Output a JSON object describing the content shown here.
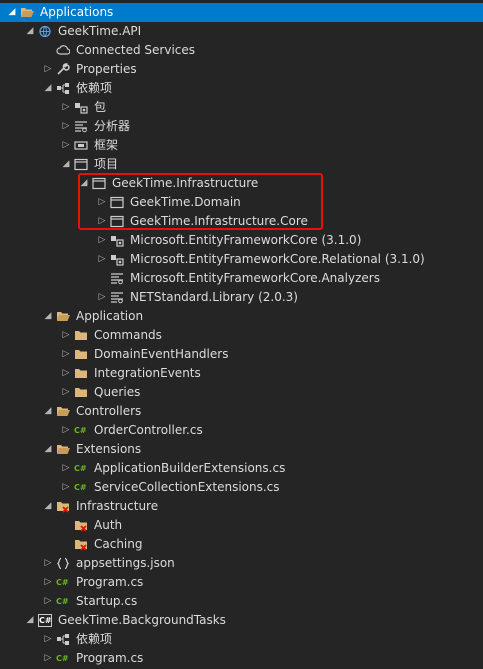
{
  "tree": {
    "items": [
      {
        "label": "Applications",
        "icon": "folder-open",
        "arrow": "expanded",
        "indent": 0,
        "selected": true
      },
      {
        "label": "GeekTime.API",
        "icon": "web-project",
        "arrow": "expanded",
        "indent": 1
      },
      {
        "label": "Connected Services",
        "icon": "connected-services",
        "arrow": "none",
        "indent": 2
      },
      {
        "label": "Properties",
        "icon": "wrench",
        "arrow": "collapsed",
        "indent": 2
      },
      {
        "label": "依赖项",
        "icon": "dependencies",
        "arrow": "expanded",
        "indent": 2
      },
      {
        "label": "包",
        "icon": "package",
        "arrow": "collapsed",
        "indent": 3
      },
      {
        "label": "分析器",
        "icon": "analyzer",
        "arrow": "collapsed",
        "indent": 3
      },
      {
        "label": "框架",
        "icon": "framework",
        "arrow": "collapsed",
        "indent": 3
      },
      {
        "label": "项目",
        "icon": "project-ref",
        "arrow": "expanded",
        "indent": 3
      },
      {
        "label": "GeekTime.Infrastructure",
        "icon": "project-ref",
        "arrow": "expanded",
        "indent": 4
      },
      {
        "label": "GeekTime.Domain",
        "icon": "project-ref",
        "arrow": "collapsed",
        "indent": 5
      },
      {
        "label": "GeekTime.Infrastructure.Core",
        "icon": "project-ref",
        "arrow": "collapsed",
        "indent": 5
      },
      {
        "label": "Microsoft.EntityFrameworkCore (3.1.0)",
        "icon": "package",
        "arrow": "collapsed",
        "indent": 5
      },
      {
        "label": "Microsoft.EntityFrameworkCore.Relational (3.1.0)",
        "icon": "package",
        "arrow": "collapsed",
        "indent": 5
      },
      {
        "label": "Microsoft.EntityFrameworkCore.Analyzers",
        "icon": "analyzer",
        "arrow": "none",
        "indent": 5
      },
      {
        "label": "NETStandard.Library (2.0.3)",
        "icon": "analyzer",
        "arrow": "collapsed",
        "indent": 5
      },
      {
        "label": "Application",
        "icon": "folder-open",
        "arrow": "expanded",
        "indent": 2
      },
      {
        "label": "Commands",
        "icon": "folder",
        "arrow": "collapsed",
        "indent": 3
      },
      {
        "label": "DomainEventHandlers",
        "icon": "folder",
        "arrow": "collapsed",
        "indent": 3
      },
      {
        "label": "IntegrationEvents",
        "icon": "folder",
        "arrow": "collapsed",
        "indent": 3
      },
      {
        "label": "Queries",
        "icon": "folder",
        "arrow": "collapsed",
        "indent": 3
      },
      {
        "label": "Controllers",
        "icon": "folder-open",
        "arrow": "expanded",
        "indent": 2
      },
      {
        "label": "OrderController.cs",
        "icon": "csharp",
        "arrow": "collapsed",
        "indent": 3
      },
      {
        "label": "Extensions",
        "icon": "folder-open",
        "arrow": "expanded",
        "indent": 2
      },
      {
        "label": "ApplicationBuilderExtensions.cs",
        "icon": "csharp",
        "arrow": "collapsed",
        "indent": 3
      },
      {
        "label": "ServiceCollectionExtensions.cs",
        "icon": "csharp",
        "arrow": "collapsed",
        "indent": 3
      },
      {
        "label": "Infrastructure",
        "icon": "folder-excluded",
        "arrow": "expanded",
        "indent": 2
      },
      {
        "label": "Auth",
        "icon": "folder-excluded",
        "arrow": "none",
        "indent": 3
      },
      {
        "label": "Caching",
        "icon": "folder-excluded",
        "arrow": "none",
        "indent": 3
      },
      {
        "label": "appsettings.json",
        "icon": "json",
        "arrow": "collapsed",
        "indent": 2
      },
      {
        "label": "Program.cs",
        "icon": "csharp",
        "arrow": "collapsed",
        "indent": 2
      },
      {
        "label": "Startup.cs",
        "icon": "csharp",
        "arrow": "collapsed",
        "indent": 2
      },
      {
        "label": "GeekTime.BackgroundTasks",
        "icon": "csharp-project",
        "arrow": "expanded",
        "indent": 1
      },
      {
        "label": "依赖项",
        "icon": "dependencies",
        "arrow": "collapsed",
        "indent": 2
      },
      {
        "label": "Program.cs",
        "icon": "csharp",
        "arrow": "collapsed",
        "indent": 2
      }
    ]
  },
  "colors": {
    "background": "#252526",
    "selection": "#007acc",
    "folder": "#dcb67a",
    "csharp": "#68b723",
    "highlight": "#e51400"
  },
  "csharp_badge": "C#"
}
